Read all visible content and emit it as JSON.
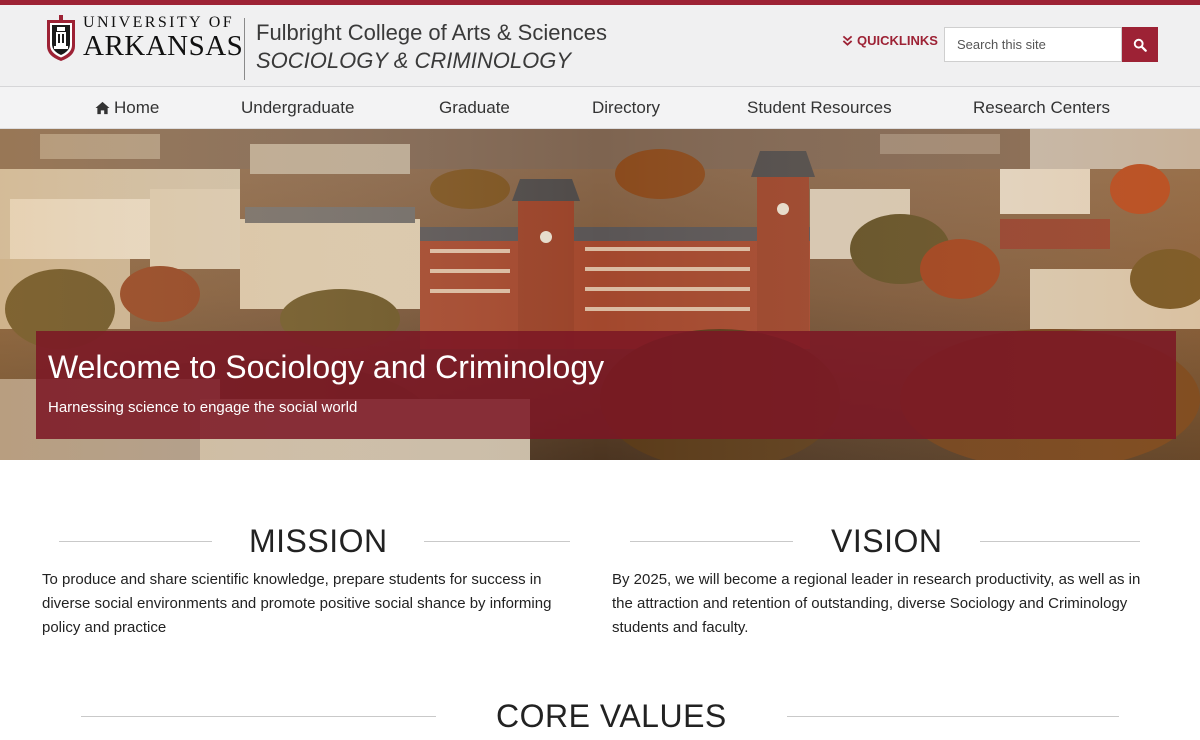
{
  "brand": {
    "university_top": "UNIVERSITY OF",
    "university_main": "ARKANSAS",
    "college": "Fulbright College of Arts & Sciences",
    "department": "SOCIOLOGY & CRIMINOLOGY",
    "accent": "#9d2235"
  },
  "header": {
    "quicklinks_label": "QUICKLINKS",
    "search_placeholder": "Search this site"
  },
  "nav": {
    "items": [
      {
        "label": "Home",
        "icon": "home-icon"
      },
      {
        "label": "Undergraduate"
      },
      {
        "label": "Graduate"
      },
      {
        "label": "Directory"
      },
      {
        "label": "Student Resources"
      },
      {
        "label": "Research Centers"
      }
    ]
  },
  "hero": {
    "title": "Welcome to Sociology and Criminology",
    "subtitle": "Harnessing science to engage the social world"
  },
  "mission": {
    "heading": "MISSION",
    "text": "To produce and share scientific knowledge, prepare students for success in diverse social environments and promote positive social shance by informing policy and practice"
  },
  "vision": {
    "heading": "VISION",
    "text": "By 2025, we will become a regional leader in research productivity, as well as in the attraction and retention of outstanding, diverse Sociology and Criminology students and faculty."
  },
  "core_values": {
    "heading": "CORE VALUES"
  }
}
